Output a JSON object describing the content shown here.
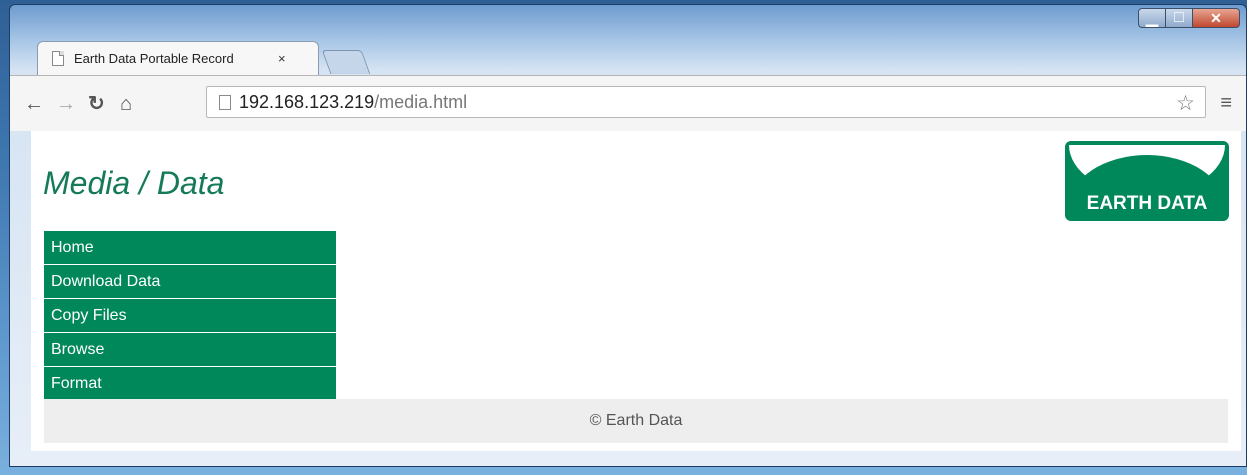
{
  "browser": {
    "tab_title": "Earth Data Portable Record",
    "tab_close": "×",
    "url_host": "192.168.123.219",
    "url_path": "/media.html",
    "icons": [
      "back-icon",
      "forward-icon",
      "reload-icon",
      "home-icon",
      "page-icon",
      "star-icon",
      "menu-icon"
    ]
  },
  "page": {
    "title": "Media / Data",
    "logo_text": "EARTH DATA",
    "nav": [
      "Home",
      "Download Data",
      "Copy Files",
      "Browse",
      "Format"
    ],
    "footer": "© Earth Data"
  },
  "colors": {
    "brand_green": "#00875a",
    "title_green": "#157a59"
  }
}
